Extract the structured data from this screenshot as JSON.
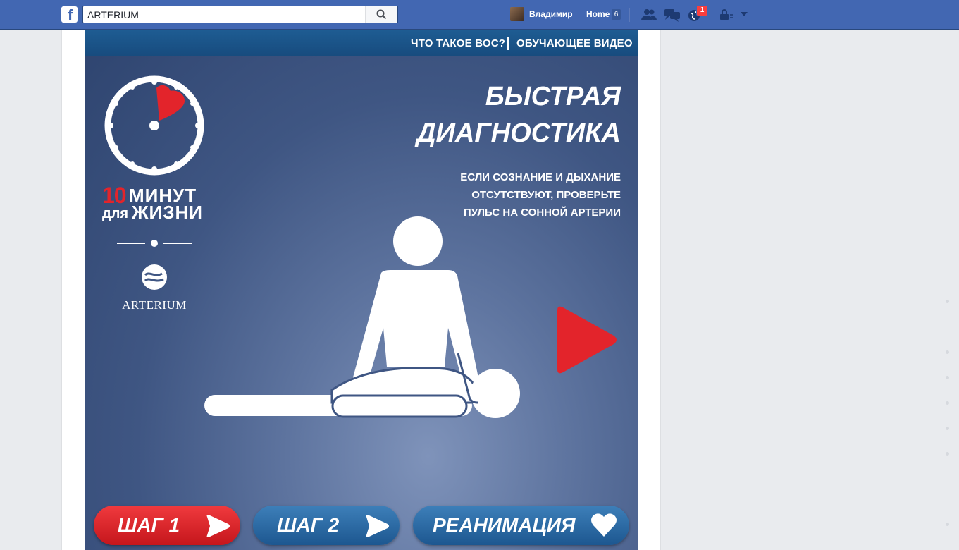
{
  "topbar": {
    "search_value": "ARTERIUM",
    "username": "Владимир",
    "home_label": "Home",
    "home_count": "6",
    "notifications_count": "1"
  },
  "banner": {
    "nav": {
      "link1": "ЧТО ТАКОЕ ВОС?",
      "link2": "ОБУЧАЮЩЕЕ ВИДЕО"
    },
    "title_line1": "БЫСТРАЯ",
    "title_line2": "ДИАГНОСТИКА",
    "subtitle_line1": "ЕСЛИ СОЗНАНИЕ И ДЫХАНИЕ",
    "subtitle_line2": "ОТСУТСТВУЮТ, ПРОВЕРЬТЕ",
    "subtitle_line3": "ПУЛЬС НА СОННОЙ АРТЕРИИ",
    "logo": {
      "number": "10",
      "word1": "МИНУТ",
      "word2": "для",
      "word3": "ЖИЗНИ"
    },
    "brand": "ARTERIUM",
    "steps": [
      {
        "label": "ШАГ 1",
        "icon": "play-arrow-icon"
      },
      {
        "label": "ШАГ 2",
        "icon": "play-arrow-icon"
      },
      {
        "label": "РЕАНИМАЦИЯ",
        "icon": "heart-icon"
      }
    ]
  },
  "colors": {
    "facebook_blue": "#4267b2",
    "accent_red": "#e3242b",
    "step_blue": "#2a6aa6"
  }
}
